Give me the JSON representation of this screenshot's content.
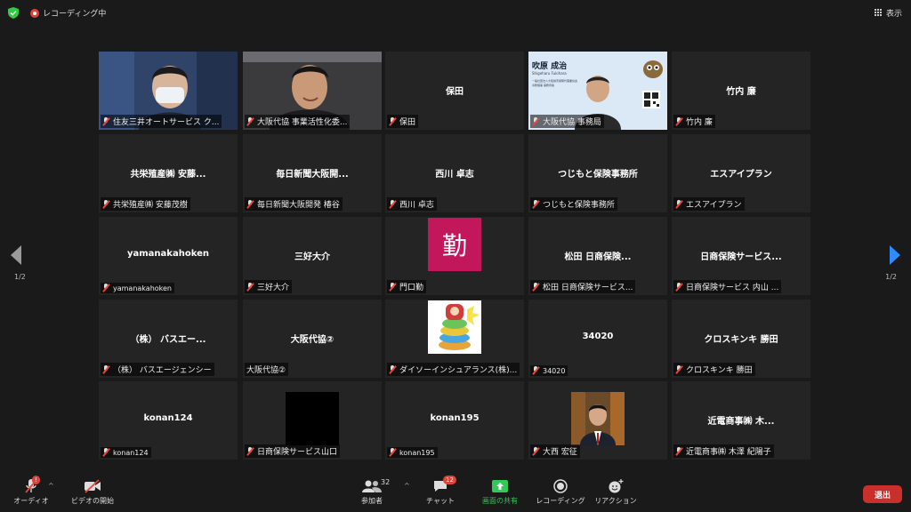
{
  "topbar": {
    "recording_label": "レコーディング中",
    "view_label": "表示"
  },
  "nav": {
    "page_left": "1/2",
    "page_right": "1/2"
  },
  "tiles": [
    {
      "name": "住友三井オートサービス ク...",
      "big": "",
      "video": "person1"
    },
    {
      "name": "大阪代協 事業活性化委...",
      "big": "",
      "video": "person2"
    },
    {
      "name": "保田",
      "big": "保田",
      "video": ""
    },
    {
      "name": "大阪代協 事務局",
      "big": "",
      "video": "slide",
      "slide_name": "吹原 成治",
      "slide_romaji": "Shigeharu Fukihara",
      "slide_org": "一般社団法人大阪損害保険代理業協会",
      "slide_role": "専務理事 事務局長"
    },
    {
      "name": "竹内 廉",
      "big": "竹内 廉",
      "video": ""
    },
    {
      "name": "共栄殖産㈱ 安藤茂樹",
      "big": "共栄殖産㈱ 安藤...",
      "video": ""
    },
    {
      "name": "毎日新聞大阪開発 椿谷",
      "big": "毎日新聞大阪開...",
      "video": ""
    },
    {
      "name": "西川 卓志",
      "big": "西川 卓志",
      "video": ""
    },
    {
      "name": "つじもと保険事務所",
      "big": "つじもと保険事務所",
      "video": ""
    },
    {
      "name": "エスアイプラン",
      "big": "エスアイプラン",
      "video": ""
    },
    {
      "name": "yamanakahoken",
      "big": "yamanakahoken",
      "video": ""
    },
    {
      "name": "三好大介",
      "big": "三好大介",
      "video": ""
    },
    {
      "name": "門口勤",
      "big": "",
      "video": "kanji",
      "kanji": "勤"
    },
    {
      "name": "松田 日商保険サービス...",
      "big": "松田 日商保険...",
      "video": ""
    },
    {
      "name": "日商保険サービス 内山 ...",
      "big": "日商保険サービス...",
      "video": ""
    },
    {
      "name": "（株） バスエージェンシー",
      "big": "（株） バスエー...",
      "video": ""
    },
    {
      "name": "大阪代協②",
      "big": "大阪代協②",
      "video": "",
      "nomic": true
    },
    {
      "name": "ダイソーインシュアランス(株)...",
      "big": "",
      "video": "cartoon"
    },
    {
      "name": "34020",
      "big": "34020",
      "video": ""
    },
    {
      "name": "クロスキンキ 勝田",
      "big": "クロスキンキ 勝田",
      "video": ""
    },
    {
      "name": "konan124",
      "big": "konan124",
      "video": ""
    },
    {
      "name": "日商保険サービス山口",
      "big": "",
      "video": "black"
    },
    {
      "name": "konan195",
      "big": "konan195",
      "video": ""
    },
    {
      "name": "大西 宏征",
      "big": "",
      "video": "portrait"
    },
    {
      "name": "近電商事㈱ 木澤 紀陽子",
      "big": "近電商事㈱ 木...",
      "video": ""
    }
  ],
  "toolbar": {
    "audio_label": "オーディオ",
    "video_label": "ビデオの開始",
    "participants_label": "参加者",
    "participants_count": "32",
    "chat_label": "チャット",
    "chat_badge": "12",
    "share_label": "画面の共有",
    "record_label": "レコーディング",
    "reaction_label": "リアクション",
    "leave_label": "退出"
  },
  "colors": {
    "active_speaker": "#cfe06a",
    "share_green": "#34c759",
    "leave_red": "#c9302c",
    "muted_red": "#e8453c"
  }
}
